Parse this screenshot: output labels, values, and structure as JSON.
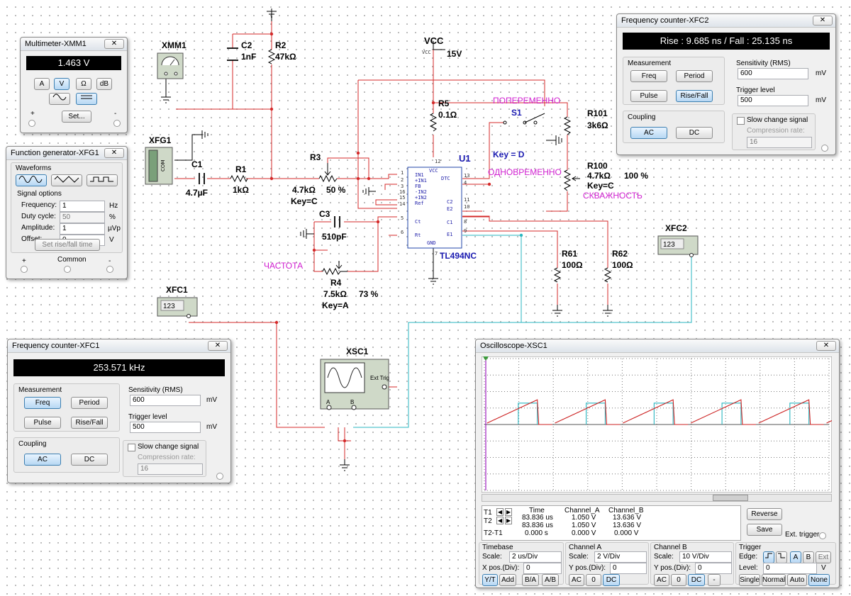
{
  "schematic": {
    "xmm1": "XMM1",
    "xfg1": "XFG1",
    "c2": {
      "name": "C2",
      "value": "1nF"
    },
    "r2": {
      "name": "R2",
      "value": "47kΩ"
    },
    "vcc": {
      "name": "VCC",
      "value": "15V",
      "pin": "VCC"
    },
    "c1": {
      "name": "C1",
      "value": "4.7µF"
    },
    "r1": {
      "name": "R1",
      "value": "1kΩ"
    },
    "r3": {
      "name": "R3",
      "value": "4.7kΩ",
      "percent": "50 %",
      "key": "Key=C"
    },
    "r5": {
      "name": "R5",
      "value": "0.1Ω"
    },
    "u1": {
      "name": "U1",
      "part": "TL494NC",
      "left_pins": [
        "IN1",
        "+IN1",
        "FB",
        "-IN2",
        "+IN2",
        "Ref",
        "Ct",
        "Rt"
      ],
      "right_pins": [
        "VCC",
        "DTC",
        "C2",
        "E2",
        "C1",
        "E1",
        "GND"
      ],
      "pin_numbers": [
        "12",
        "13",
        "4",
        "11",
        "10",
        "8",
        "9",
        "7",
        "1",
        "2",
        "3",
        "16",
        "15",
        "14",
        "5",
        "6"
      ]
    },
    "s1": {
      "name": "S1",
      "key": "Key = D"
    },
    "r101": {
      "name": "R101",
      "value": "3k6Ω"
    },
    "r100": {
      "name": "R100",
      "value": "4.7kΩ",
      "percent": "100 %",
      "key": "Key=C"
    },
    "c3": {
      "name": "C3",
      "value": "510pF"
    },
    "r4": {
      "name": "R4",
      "value": "7.5kΩ",
      "percent": "73 %",
      "key": "Key=A"
    },
    "r61": {
      "name": "R61",
      "value": "100Ω"
    },
    "r62": {
      "name": "R62",
      "value": "100Ω"
    },
    "xfc1": {
      "name": "XFC1",
      "display": "123"
    },
    "xfc2": {
      "name": "XFC2",
      "display": "123"
    },
    "xsc1": {
      "name": "XSC1",
      "ext_trig": "Ext Trig",
      "a": "A",
      "b": "B"
    },
    "notes": {
      "alternately": "ПОПЕРЕМЕННО",
      "simultaneously": "ОДНОВРЕМЕННО",
      "duty": "СКВАЖНОСТЬ",
      "frequency": "ЧАСТОТА"
    }
  },
  "multimeter": {
    "title": "Multimeter-XMM1",
    "display": "1.463 V",
    "buttons": [
      "A",
      "V",
      "Ω",
      "dB"
    ],
    "selected": "V",
    "set_label": "Set...",
    "plus": "+",
    "minus": "-"
  },
  "function_generator": {
    "title": "Function generator-XFG1",
    "waveforms_label": "Waveforms",
    "signal_options_label": "Signal options",
    "fields": [
      {
        "label": "Frequency:",
        "value": "1",
        "unit": "Hz"
      },
      {
        "label": "Duty cycle:",
        "value": "50",
        "unit": "%"
      },
      {
        "label": "Amplitude:",
        "value": "1",
        "unit": "µVp"
      },
      {
        "label": "Offset:",
        "value": "0",
        "unit": "V"
      }
    ],
    "rise_fall_button": "Set rise/fall time",
    "plus": "+",
    "common": "Common",
    "minus": "-"
  },
  "counter_xfc2": {
    "title": "Frequency counter-XFC2",
    "display": "Rise : 9.685 ns / Fall : 25.135 ns",
    "measurement_label": "Measurement",
    "buttons": [
      "Freq",
      "Period",
      "Pulse",
      "Rise/Fall"
    ],
    "selected": "Rise/Fall",
    "coupling_label": "Coupling",
    "coupling": [
      "AC",
      "DC"
    ],
    "coupling_selected": "AC",
    "sensitivity_label": "Sensitivity (RMS)",
    "sensitivity": "600",
    "sensitivity_unit": "mV",
    "trigger_label": "Trigger level",
    "trigger": "500",
    "trigger_unit": "mV",
    "slow_label": "Slow change signal",
    "compression_label": "Compression rate:",
    "compression": "16"
  },
  "counter_xfc1": {
    "title": "Frequency counter-XFC1",
    "display": "253.571 kHz",
    "measurement_label": "Measurement",
    "buttons": [
      "Freq",
      "Period",
      "Pulse",
      "Rise/Fall"
    ],
    "selected": "Freq",
    "coupling_label": "Coupling",
    "coupling": [
      "AC",
      "DC"
    ],
    "coupling_selected": "AC",
    "sensitivity_label": "Sensitivity (RMS)",
    "sensitivity": "600",
    "sensitivity_unit": "mV",
    "trigger_label": "Trigger level",
    "trigger": "500",
    "trigger_unit": "mV",
    "slow_label": "Slow change signal",
    "compression_label": "Compression rate:",
    "compression": "16"
  },
  "oscilloscope": {
    "title": "Oscilloscope-XSC1",
    "headers": [
      "Time",
      "Channel_A",
      "Channel_B"
    ],
    "rows": [
      {
        "label": "T1",
        "time": "83.836 us",
        "a": "1.050 V",
        "b": "13.636 V"
      },
      {
        "label": "T2",
        "time": "83.836 us",
        "a": "1.050 V",
        "b": "13.636 V"
      },
      {
        "label": "T2-T1",
        "time": "0.000 s",
        "a": "0.000 V",
        "b": "0.000 V"
      }
    ],
    "reverse": "Reverse",
    "save": "Save",
    "ext_trigger": "Ext. trigger",
    "timebase": {
      "label": "Timebase",
      "scale_label": "Scale:",
      "scale": "2 us/Div",
      "pos_label": "X pos.(Div):",
      "pos": "0",
      "buttons": [
        "Y/T",
        "Add",
        "B/A",
        "A/B"
      ]
    },
    "channel_a": {
      "label": "Channel A",
      "scale_label": "Scale:",
      "scale": "2 V/Div",
      "pos_label": "Y pos.(Div):",
      "pos": "0",
      "buttons": [
        "AC",
        "0",
        "DC"
      ]
    },
    "channel_b": {
      "label": "Channel B",
      "scale_label": "Scale:",
      "scale": "10 V/Div",
      "pos_label": "Y pos.(Div):",
      "pos": "0",
      "buttons": [
        "AC",
        "0",
        "DC",
        "-"
      ]
    },
    "trigger": {
      "label": "Trigger",
      "edge_label": "Edge:",
      "level_label": "Level:",
      "level": "0",
      "level_unit": "V",
      "edge_buttons": [
        "A",
        "B",
        "Ext"
      ],
      "mode_buttons": [
        "Single",
        "Normal",
        "Auto",
        "None"
      ]
    },
    "colors": {
      "channel_a": "#cc2222",
      "channel_b": "#2ab6c0",
      "cursor": "#a020c0"
    }
  }
}
